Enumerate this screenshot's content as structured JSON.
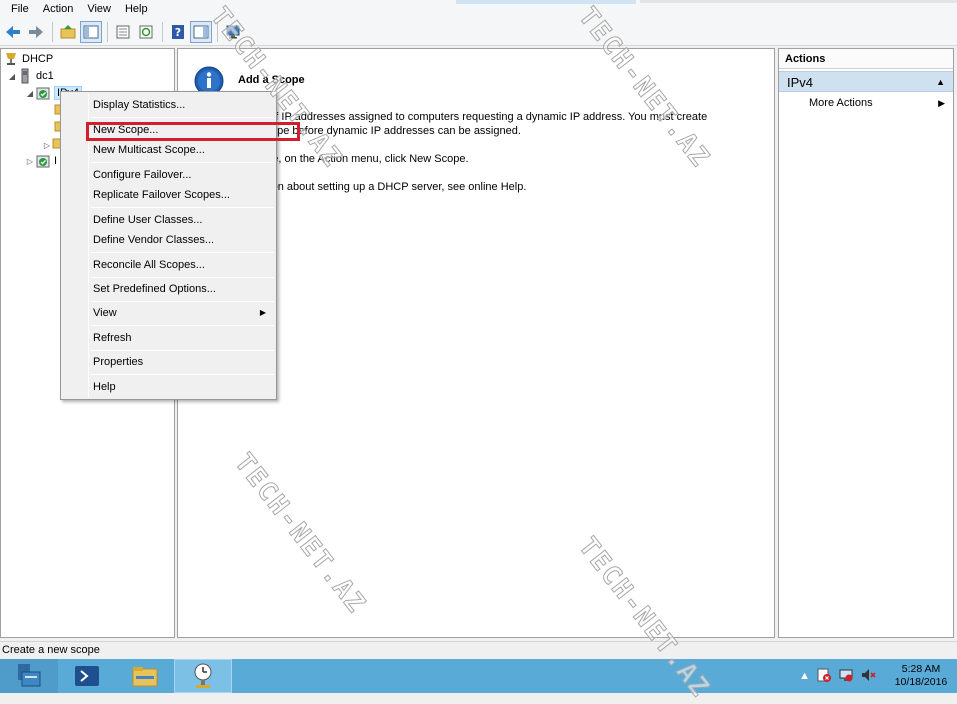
{
  "menubar": {
    "items": [
      "File",
      "Action",
      "View",
      "Help"
    ]
  },
  "toolbar": {
    "buttons": [
      "back-icon",
      "forward-icon",
      "up-folder-icon",
      "show-hide-tree-icon",
      "export-list-icon",
      "refresh-icon",
      "help-icon",
      "show-hide-action-pane-icon",
      "server-icon"
    ]
  },
  "tree": {
    "root": "DHCP",
    "server": "dc1",
    "ipv4": "IPv4",
    "hidden_label": "I"
  },
  "content": {
    "title": "Add a Scope",
    "line1": "e of IP addresses assigned to computers requesting a dynamic IP address. You must create",
    "line2": "scope before dynamic IP addresses can be assigned.",
    "line3": "ope, on the Action menu, click New Scope.",
    "line4": "ation about setting up a DHCP server, see online Help."
  },
  "actions": {
    "header": "Actions",
    "group": "IPv4",
    "more": "More Actions"
  },
  "context_menu": {
    "items": [
      "Display Statistics...",
      "New Scope...",
      "New Multicast Scope...",
      "Configure Failover...",
      "Replicate Failover Scopes...",
      "Define User Classes...",
      "Define Vendor Classes...",
      "Reconcile All Scopes...",
      "Set Predefined Options...",
      "View",
      "Refresh",
      "Properties",
      "Help"
    ],
    "highlighted": "New Scope..."
  },
  "statusbar": {
    "text": "Create a new scope"
  },
  "taskbar": {
    "clock_time": "5:28 AM",
    "clock_date": "10/18/2016"
  },
  "watermark": "TECH-NET.AZ",
  "colors": {
    "highlight_border": "#d21f2c",
    "taskbar": "#5aaad8",
    "actions_group": "#cfe0f1",
    "info_blue": "#1e5fb5"
  }
}
